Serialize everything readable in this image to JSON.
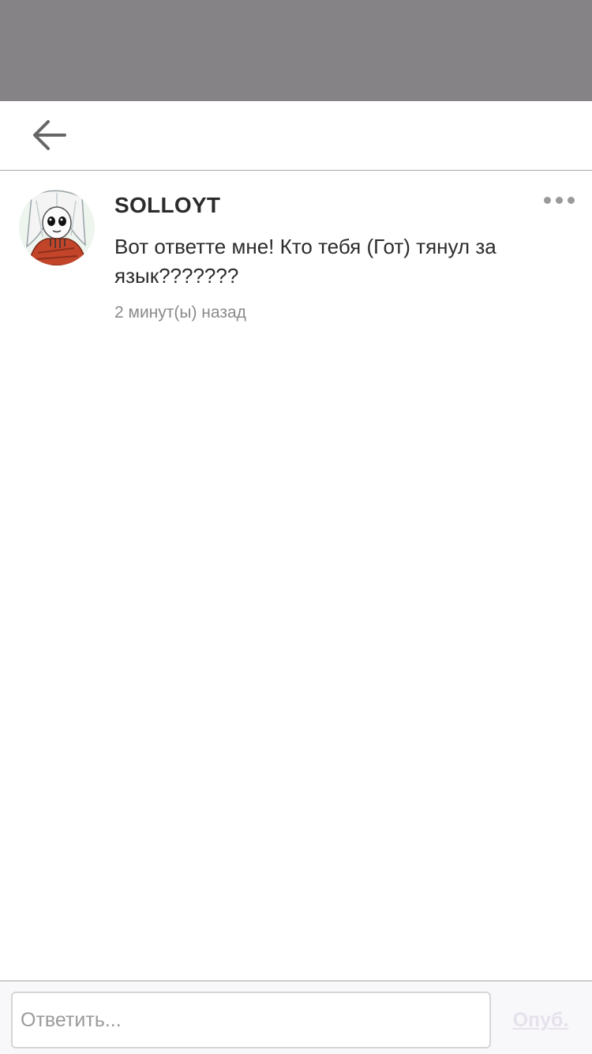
{
  "nav": {
    "back_icon": "arrow-left-icon"
  },
  "comment": {
    "author": "SOLLOYT",
    "text": "Вот ответте мне! Кто тебя (Гот) тянул за язык???????",
    "time": "2 минут(ы) назад",
    "more_icon": "more-dots-icon"
  },
  "reply": {
    "placeholder": "Ответить...",
    "value": "",
    "publish_label": "Опуб."
  },
  "colors": {
    "overlay": "#858385",
    "text": "#2b2b2b",
    "muted": "#8a8a8a",
    "publish_disabled": "#e6e2ec"
  }
}
